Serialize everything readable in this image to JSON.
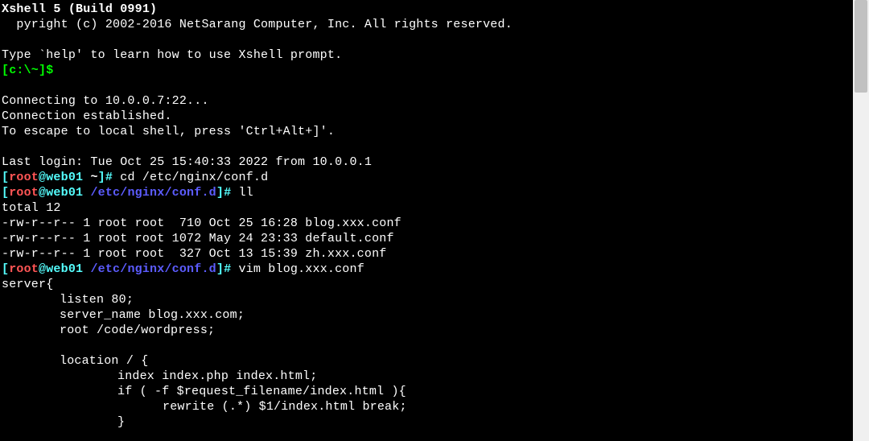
{
  "header": {
    "title": "Xshell 5 (Build 0991)",
    "copyright": "  pyright (c) 2002-2016 NetSarang Computer, Inc. All rights reserved."
  },
  "intro": {
    "help": "Type `help' to learn how to use Xshell prompt.",
    "prompt_open": "[",
    "prompt_path": "c:\\~",
    "prompt_close": "]$"
  },
  "connect": {
    "connecting": "Connecting to 10.0.0.7:22...",
    "established": "Connection established.",
    "escape": "To escape to local shell, press 'Ctrl+Alt+]'."
  },
  "login": {
    "last": "Last login: Tue Oct 25 15:40:33 2022 from 10.0.0.1"
  },
  "prompts": {
    "p1_open": "[",
    "p1_user": "root",
    "p1_at": "@",
    "p1_host": "web01",
    "p1_space": " ",
    "p1_path": "~",
    "p1_close": "]# ",
    "p1_cmd": "cd /etc/nginx/conf.d",
    "p2_open": "[",
    "p2_user": "root",
    "p2_at": "@",
    "p2_host": "web01",
    "p2_space": " ",
    "p2_path": "/etc/nginx/conf.d",
    "p2_close": "]# ",
    "p2_cmd": "ll",
    "p3_open": "[",
    "p3_user": "root",
    "p3_at": "@",
    "p3_host": "web01",
    "p3_space": " ",
    "p3_path": "/etc/nginx/conf.d",
    "p3_close": "]# ",
    "p3_cmd": "vim blog.xxx.conf"
  },
  "listing": {
    "total": "total 12",
    "row1": "-rw-r--r-- 1 root root  710 Oct 25 16:28 blog.xxx.conf",
    "row2": "-rw-r--r-- 1 root root 1072 May 24 23:33 default.conf",
    "row3": "-rw-r--r-- 1 root root  327 Oct 13 15:39 zh.xxx.conf"
  },
  "conf": {
    "l1": "server{",
    "l2": "listen 80;",
    "l3": "server_name blog.xxx.com;",
    "l4": "root /code/wordpress;",
    "l5": "location / {",
    "l6": "index index.php index.html;",
    "l7": "if ( -f $request_filename/index.html ){",
    "l8": "rewrite (.*) $1/index.html break;",
    "l9": "}"
  }
}
